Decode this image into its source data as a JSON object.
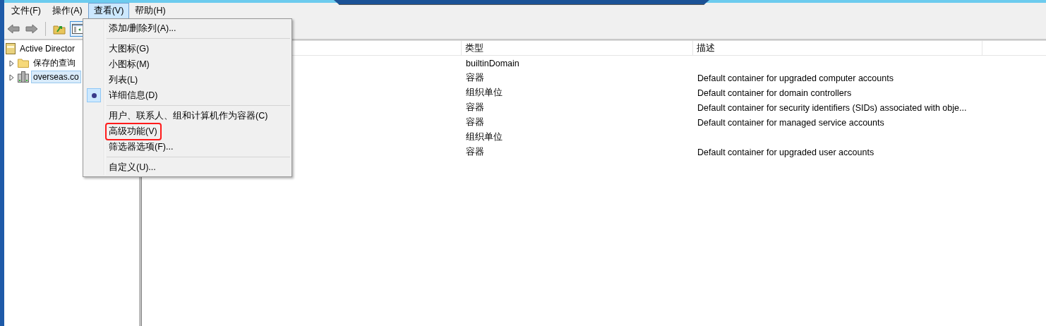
{
  "menu_bar": [
    {
      "label": "文件(F)",
      "selected": false
    },
    {
      "label": "操作(A)",
      "selected": false
    },
    {
      "label": "查看(V)",
      "selected": true
    },
    {
      "label": "帮助(H)",
      "selected": false
    }
  ],
  "toolbar": [
    {
      "kind": "back",
      "pressed": false
    },
    {
      "kind": "forward",
      "pressed": false
    },
    {
      "kind": "separator"
    },
    {
      "kind": "up",
      "pressed": false
    },
    {
      "kind": "console_tree",
      "pressed": true
    }
  ],
  "tree": [
    {
      "label": "Active Director",
      "kind": "root",
      "selected": false,
      "children": [
        {
          "label": "保存的查询",
          "kind": "folder",
          "expanded": false,
          "selected": false
        },
        {
          "label": "overseas.co",
          "kind": "domain",
          "expanded": false,
          "selected": true
        }
      ]
    }
  ],
  "list": {
    "columns": [
      "类型",
      "描述"
    ],
    "rows": [
      {
        "type": "builtinDomain"
      },
      {
        "type": "容器",
        "description": "Default container for upgraded computer accounts"
      },
      {
        "type": "组织单位",
        "description": "Default container for domain controllers"
      },
      {
        "type": "容器",
        "description": "Default container for security identifiers (SIDs) associated with obje..."
      },
      {
        "type": "容器",
        "description": "Default container for managed service accounts"
      },
      {
        "type": "组织单位"
      },
      {
        "type": "容器",
        "description": "Default container for upgraded user accounts"
      }
    ]
  },
  "view_menu": {
    "items": [
      {
        "kind": "item",
        "label": "添加/删除列(A)...",
        "checked": false,
        "highlighted": false
      },
      {
        "kind": "separator"
      },
      {
        "kind": "item",
        "label": "大图标(G)",
        "checked": false,
        "highlighted": false
      },
      {
        "kind": "item",
        "label": "小图标(M)",
        "checked": false,
        "highlighted": false
      },
      {
        "kind": "item",
        "label": "列表(L)",
        "checked": false,
        "highlighted": false
      },
      {
        "kind": "item",
        "label": "详细信息(D)",
        "checked": true,
        "highlighted": false
      },
      {
        "kind": "separator"
      },
      {
        "kind": "item",
        "label": "用户、联系人、组和计算机作为容器(C)",
        "checked": false,
        "highlighted": false
      },
      {
        "kind": "item",
        "label": "高级功能(V)",
        "checked": false,
        "highlighted": true
      },
      {
        "kind": "item",
        "label": "筛选器选项(F)...",
        "checked": false,
        "highlighted": false
      },
      {
        "kind": "separator"
      },
      {
        "kind": "item",
        "label": "自定义(U)...",
        "checked": false,
        "highlighted": false
      }
    ]
  }
}
